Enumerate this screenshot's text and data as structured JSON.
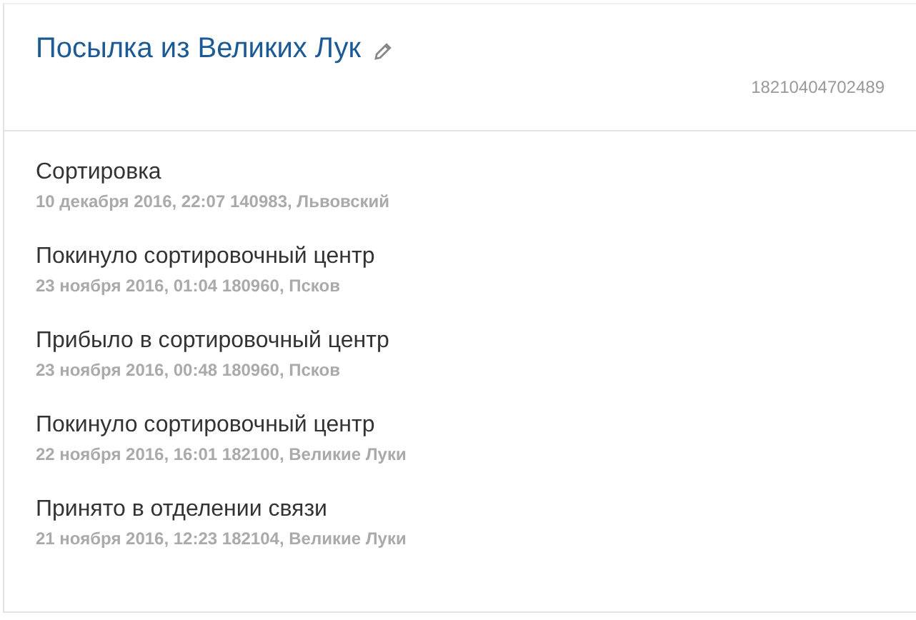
{
  "parcel": {
    "title": "Посылка из Великих Лук",
    "track_number": "18210404702489"
  },
  "events": [
    {
      "status": "Сортировка",
      "details": "10 декабря 2016, 22:07 140983, Львовский"
    },
    {
      "status": "Покинуло сортировочный центр",
      "details": "23 ноября 2016, 01:04 180960, Псков"
    },
    {
      "status": "Прибыло в сортировочный центр",
      "details": "23 ноября 2016, 00:48 180960, Псков"
    },
    {
      "status": "Покинуло сортировочный центр",
      "details": "22 ноября 2016, 16:01 182100, Великие Луки"
    },
    {
      "status": "Принято в отделении связи",
      "details": "21 ноября 2016, 12:23 182104, Великие Луки"
    }
  ]
}
